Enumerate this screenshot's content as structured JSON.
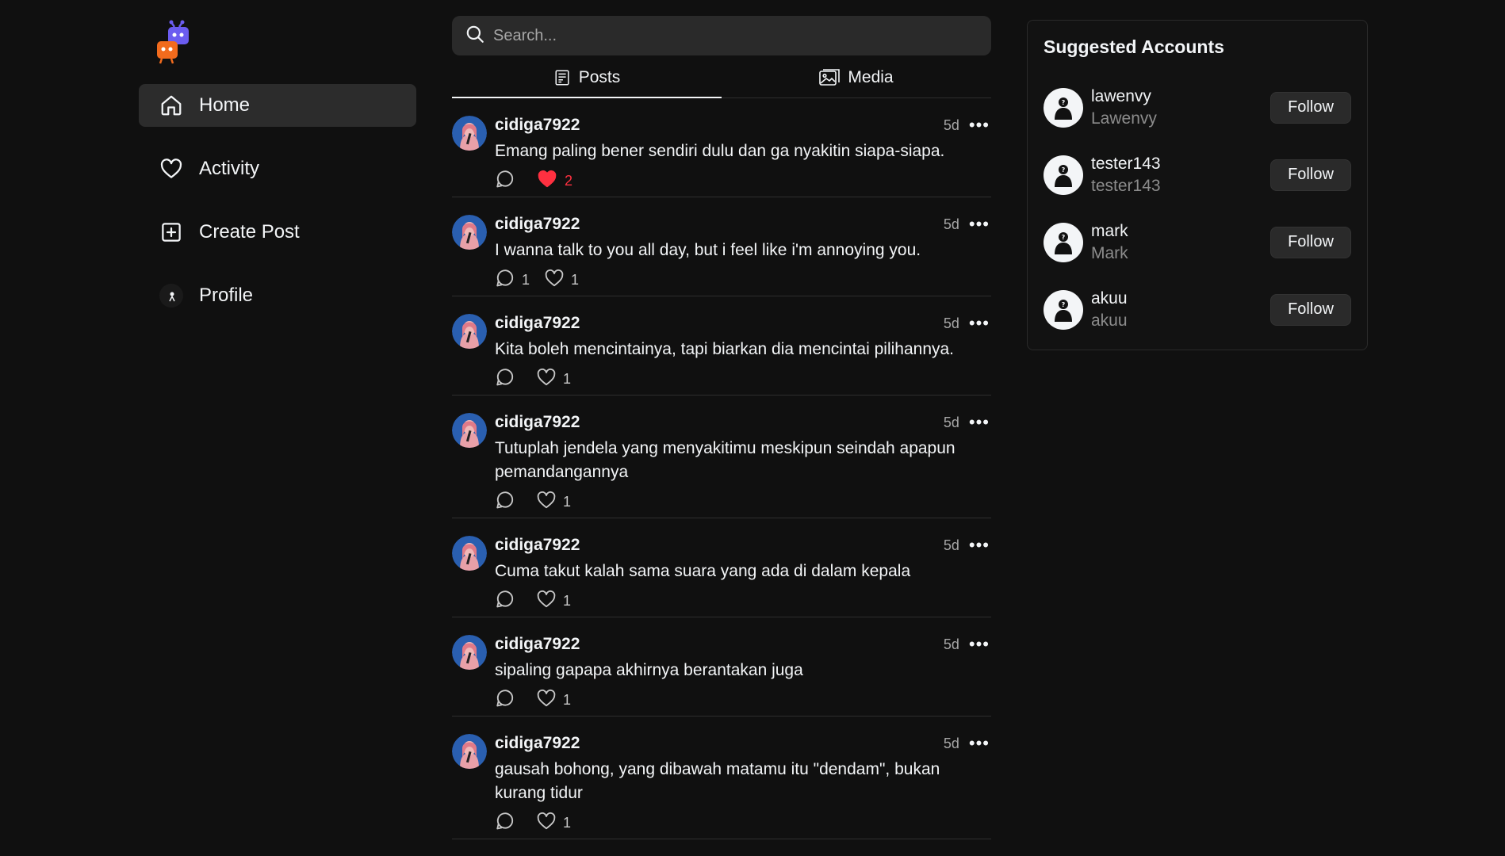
{
  "nav": {
    "items": [
      {
        "label": "Home",
        "icon": "home-icon",
        "active": true
      },
      {
        "label": "Activity",
        "icon": "heart-icon",
        "active": false
      },
      {
        "label": "Create Post",
        "icon": "plus-square-icon",
        "active": false
      },
      {
        "label": "Profile",
        "icon": "profile-avatar",
        "active": false
      }
    ]
  },
  "search": {
    "placeholder": "Search..."
  },
  "tabs": [
    {
      "label": "Posts",
      "icon": "posts-icon",
      "active": true
    },
    {
      "label": "Media",
      "icon": "media-icon",
      "active": false
    }
  ],
  "posts": [
    {
      "username": "cidiga7922",
      "time": "5d",
      "text": "Emang paling bener sendiri dulu dan ga nyakitin siapa-siapa.",
      "replies": "",
      "likes": "2",
      "liked": true
    },
    {
      "username": "cidiga7922",
      "time": "5d",
      "text": "I wanna talk to you all day, but i feel like i'm annoying you.",
      "replies": "1",
      "likes": "1",
      "liked": false
    },
    {
      "username": "cidiga7922",
      "time": "5d",
      "text": "Kita boleh mencintainya, tapi biarkan dia mencintai pilihannya.",
      "replies": "",
      "likes": "1",
      "liked": false
    },
    {
      "username": "cidiga7922",
      "time": "5d",
      "text": "Tutuplah jendela yang menyakitimu meskipun seindah apapun pemandangannya",
      "replies": "",
      "likes": "1",
      "liked": false
    },
    {
      "username": "cidiga7922",
      "time": "5d",
      "text": "Cuma takut kalah sama suara yang ada di dalam kepala",
      "replies": "",
      "likes": "1",
      "liked": false
    },
    {
      "username": "cidiga7922",
      "time": "5d",
      "text": "sipaling gapapa akhirnya berantakan juga",
      "replies": "",
      "likes": "1",
      "liked": false
    },
    {
      "username": "cidiga7922",
      "time": "5d",
      "text": "gausah bohong, yang dibawah matamu itu \"dendam\", bukan kurang tidur",
      "replies": "",
      "likes": "1",
      "liked": false
    }
  ],
  "suggested": {
    "title": "Suggested Accounts",
    "follow_label": "Follow",
    "accounts": [
      {
        "username": "lawenvy",
        "name": "Lawenvy"
      },
      {
        "username": "tester143",
        "name": "tester143"
      },
      {
        "username": "mark",
        "name": "Mark"
      },
      {
        "username": "akuu",
        "name": "akuu"
      }
    ]
  },
  "colors": {
    "background": "#101010",
    "like_active": "#ff3040",
    "muted_text": "#a6a6a6"
  }
}
